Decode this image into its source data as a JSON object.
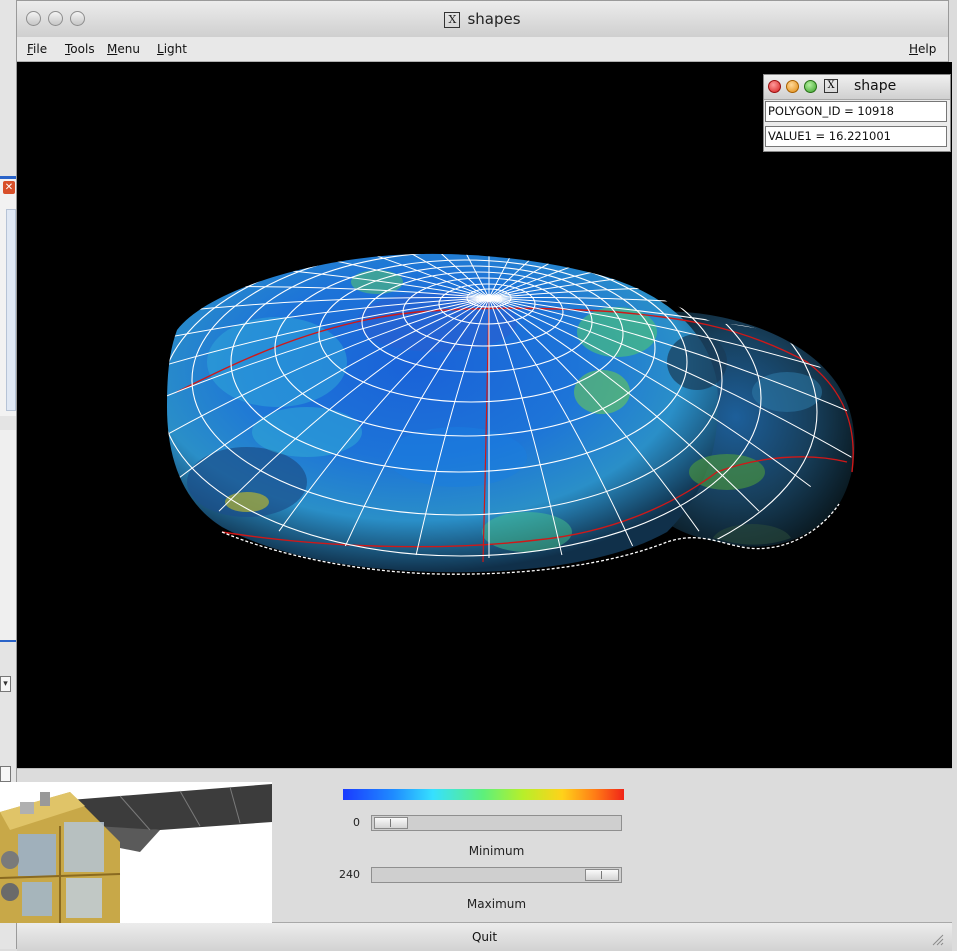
{
  "window": {
    "title": "shapes",
    "title_icon": "X"
  },
  "menubar": {
    "items": [
      {
        "label": "File"
      },
      {
        "label": "Tools"
      },
      {
        "label": "Menu"
      },
      {
        "label": "Light"
      }
    ],
    "help_label": "Help"
  },
  "info_popup": {
    "title": "shape",
    "title_icon": "X",
    "polygon_field": "POLYGON_ID = 10918",
    "value_field": "VALUE1 = 16.221001"
  },
  "colorbar": {
    "colors": [
      "#1a3bff",
      "#36e0ff",
      "#5ef07a",
      "#ffd21a",
      "#f02418"
    ]
  },
  "min_slider": {
    "value_text": "0",
    "label": "Minimum",
    "fraction": 0.0
  },
  "max_slider": {
    "value_text": "240",
    "label": "Maximum",
    "fraction": 1.0
  },
  "quit_label": "Quit",
  "icons": {
    "close": "close-icon",
    "minimize": "minimize-icon",
    "zoom": "zoom-icon",
    "x11": "x11-icon"
  }
}
